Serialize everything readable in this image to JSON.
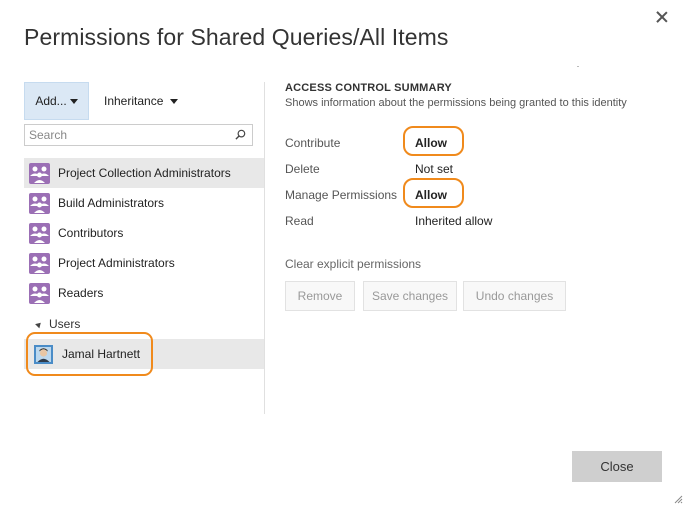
{
  "dialog": {
    "title": "Permissions for Shared Queries/All Items",
    "close_icon": "close-icon",
    "close_button": "Close"
  },
  "left": {
    "add_label": "Add...",
    "inheritance_label": "Inheritance",
    "search_placeholder": "Search",
    "groups": [
      "Project Collection Administrators",
      "Build Administrators",
      "Contributors",
      "Project Administrators",
      "Readers"
    ],
    "users_section_label": "Users",
    "users": [
      "Jamal Hartnett"
    ]
  },
  "summary": {
    "title": "ACCESS CONTROL SUMMARY",
    "subtitle": "Shows information about the permissions being granted to this identity",
    "permissions": [
      {
        "name": "Contribute",
        "value": "Allow"
      },
      {
        "name": "Delete",
        "value": "Not set"
      },
      {
        "name": "Manage Permissions",
        "value": "Allow"
      },
      {
        "name": "Read",
        "value": "Inherited allow"
      }
    ],
    "clear_link": "Clear explicit permissions",
    "buttons": {
      "remove": "Remove",
      "save": "Save changes",
      "undo": "Undo changes"
    }
  },
  "colors": {
    "highlight": "#f08a1c",
    "group_icon": "#9b6fb5",
    "selected_row": "#e8e8e8",
    "add_button": "#dbe8f5"
  }
}
